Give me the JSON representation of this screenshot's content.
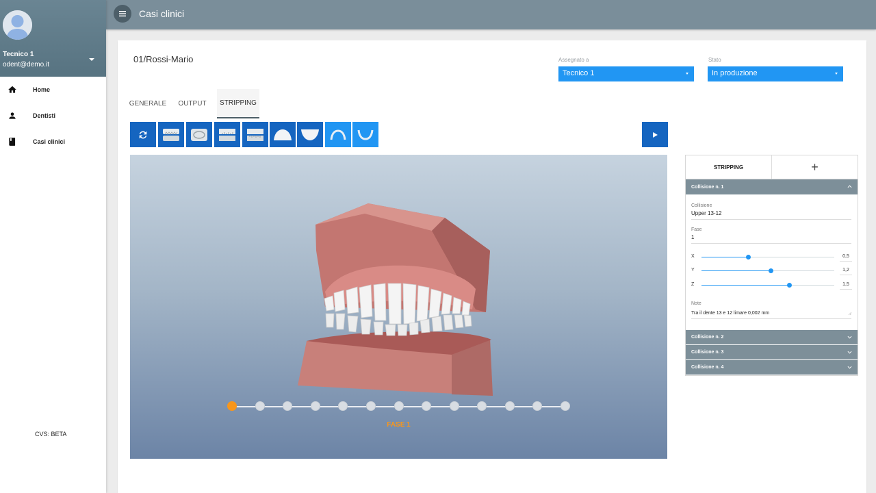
{
  "sidebar": {
    "user_name": "Tecnico 1",
    "user_email": "odent@demo.it",
    "items": [
      {
        "label": "Home",
        "icon": "home-icon"
      },
      {
        "label": "Dentisti",
        "icon": "person-icon"
      },
      {
        "label": "Casi clinici",
        "icon": "book-icon"
      }
    ],
    "footer": "CVS: BETA"
  },
  "topbar": {
    "title": "Casi clinici",
    "menu_icon": "menu-icon"
  },
  "case": {
    "title": "01/Rossi-Mario",
    "assigned_label": "Assegnato a",
    "assigned_value": "Tecnico 1",
    "status_label": "Stato",
    "status_value": "In produzione"
  },
  "tabs": [
    {
      "label": "GENERALE",
      "active": false
    },
    {
      "label": "OUTPUT",
      "active": false
    },
    {
      "label": "STRIPPING",
      "active": true
    }
  ],
  "toolbar": {
    "buttons": [
      "refresh-icon",
      "front-view-icon",
      "occlusal-view-icon",
      "left-view-icon",
      "right-view-icon",
      "upper-arch-view-icon",
      "lower-arch-view-icon",
      "upper-arch-toggle-icon",
      "lower-arch-toggle-icon"
    ],
    "play_icon": "play-icon"
  },
  "viewer": {
    "phase_label": "FASE 1",
    "phase_count": 13,
    "active_phase": 1
  },
  "panel": {
    "tab_label": "STRIPPING",
    "add_symbol": "+",
    "collisions": [
      {
        "title": "Collisione n. 1",
        "expanded": true
      },
      {
        "title": "Collisione n. 2",
        "expanded": false
      },
      {
        "title": "Collisione n. 3",
        "expanded": false
      },
      {
        "title": "Collisione n. 4",
        "expanded": false
      }
    ],
    "detail": {
      "collision_label": "Collisione",
      "collision_value": "Upper 13-12",
      "phase_label": "Fase",
      "phase_value": "1",
      "sliders": [
        {
          "label": "X",
          "value": "0,5",
          "level": 0.35
        },
        {
          "label": "Y",
          "value": "1,2",
          "level": 0.52
        },
        {
          "label": "Z",
          "value": "1,5",
          "level": 0.66
        }
      ],
      "note_label": "Note",
      "note_value": "Tra il dente 13 e 12 limare 0,002 mm"
    }
  },
  "colors": {
    "accent": "#2196f3",
    "dark_button": "#1565c0",
    "phase": "#f7961c",
    "topbar": "#7a8e9a"
  }
}
